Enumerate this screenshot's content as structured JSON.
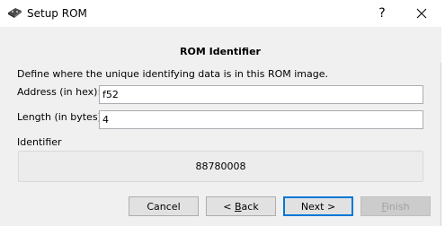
{
  "window": {
    "title": "Setup ROM",
    "help_glyph": "?",
    "icons": {
      "app": "gamepad-icon",
      "close": "close-icon"
    }
  },
  "header": {
    "title": "ROM Identifier"
  },
  "form": {
    "description": "Define where the unique identifying data is in this ROM image.",
    "address_label": "Address (in hex):",
    "address_value": "f52",
    "length_label": "Length (in bytes):",
    "length_value": "4",
    "identifier_label": "Identifier",
    "identifier_value": "88780008"
  },
  "buttons": {
    "cancel": "Cancel",
    "back_prefix": "< ",
    "back_mnemonic": "B",
    "back_rest": "ack",
    "next": "Next >",
    "finish_mnemonic": "F",
    "finish_rest": "inish"
  },
  "colors": {
    "accent": "#0078d7"
  }
}
